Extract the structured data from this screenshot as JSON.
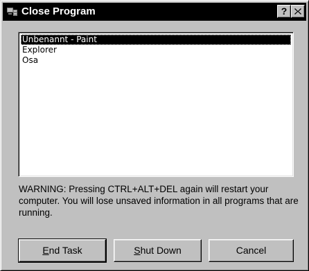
{
  "window": {
    "title": "Close Program",
    "help_label": "?",
    "close_label": "×"
  },
  "tasks": [
    {
      "label": "Unbenannt - Paint",
      "selected": true
    },
    {
      "label": "Explorer",
      "selected": false
    },
    {
      "label": "Osa",
      "selected": false
    }
  ],
  "warning": "WARNING: Pressing CTRL+ALT+DEL again will restart your computer. You will lose unsaved information in all programs that are running.",
  "buttons": {
    "end_task": {
      "mnemonic": "E",
      "rest": "nd Task"
    },
    "shut_down": {
      "mnemonic": "S",
      "rest": "hut Down"
    },
    "cancel": {
      "label": "Cancel"
    }
  },
  "colors": {
    "titlebar": "#000000",
    "face": "#c0c0c0",
    "selection": "#000000"
  }
}
